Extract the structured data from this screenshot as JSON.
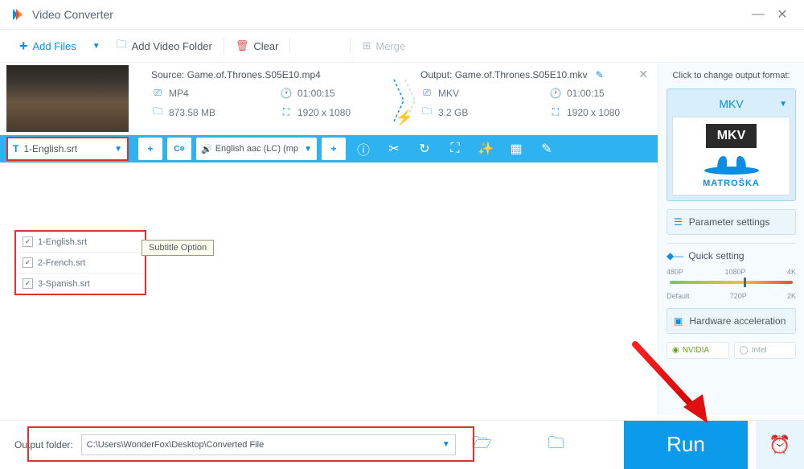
{
  "app": {
    "title": "Video Converter"
  },
  "toolbar": {
    "add_files": "Add Files",
    "add_folder": "Add Video Folder",
    "clear": "Clear",
    "merge": "Merge"
  },
  "file": {
    "source_label": "Source:",
    "source_name": "Game.of.Thrones.S05E10.mp4",
    "src_format": "MP4",
    "src_duration": "01:00:15",
    "src_size": "873.58 MB",
    "src_res": "1920 x 1080",
    "output_label": "Output:",
    "output_name": "Game.of.Thrones.S05E10.mkv",
    "out_format": "MKV",
    "out_duration": "01:00:15",
    "out_size": "3.2 GB",
    "out_res": "1920 x 1080"
  },
  "settings": {
    "subtitle_selected": "1-English.srt",
    "audio_selected": "English aac (LC) (mp",
    "tooltip": "Subtitle Option",
    "subtitles": [
      "1-English.srt",
      "2-French.srt",
      "3-Spanish.srt"
    ]
  },
  "right": {
    "header": "Click to change output format:",
    "format": "MKV",
    "mkv_badge": "MKV",
    "matroska": "MATROŠKA",
    "param": "Parameter settings",
    "quick": "Quick setting",
    "ticks_top": [
      "480P",
      "1080P",
      "4K"
    ],
    "ticks_bot": [
      "Default",
      "720P",
      "2K"
    ],
    "hw": "Hardware acceleration",
    "nvidia": "NVIDIA",
    "intel": "Intel"
  },
  "bottom": {
    "label": "Output folder:",
    "path": "C:\\Users\\WonderFox\\Desktop\\Converted File",
    "run": "Run"
  }
}
